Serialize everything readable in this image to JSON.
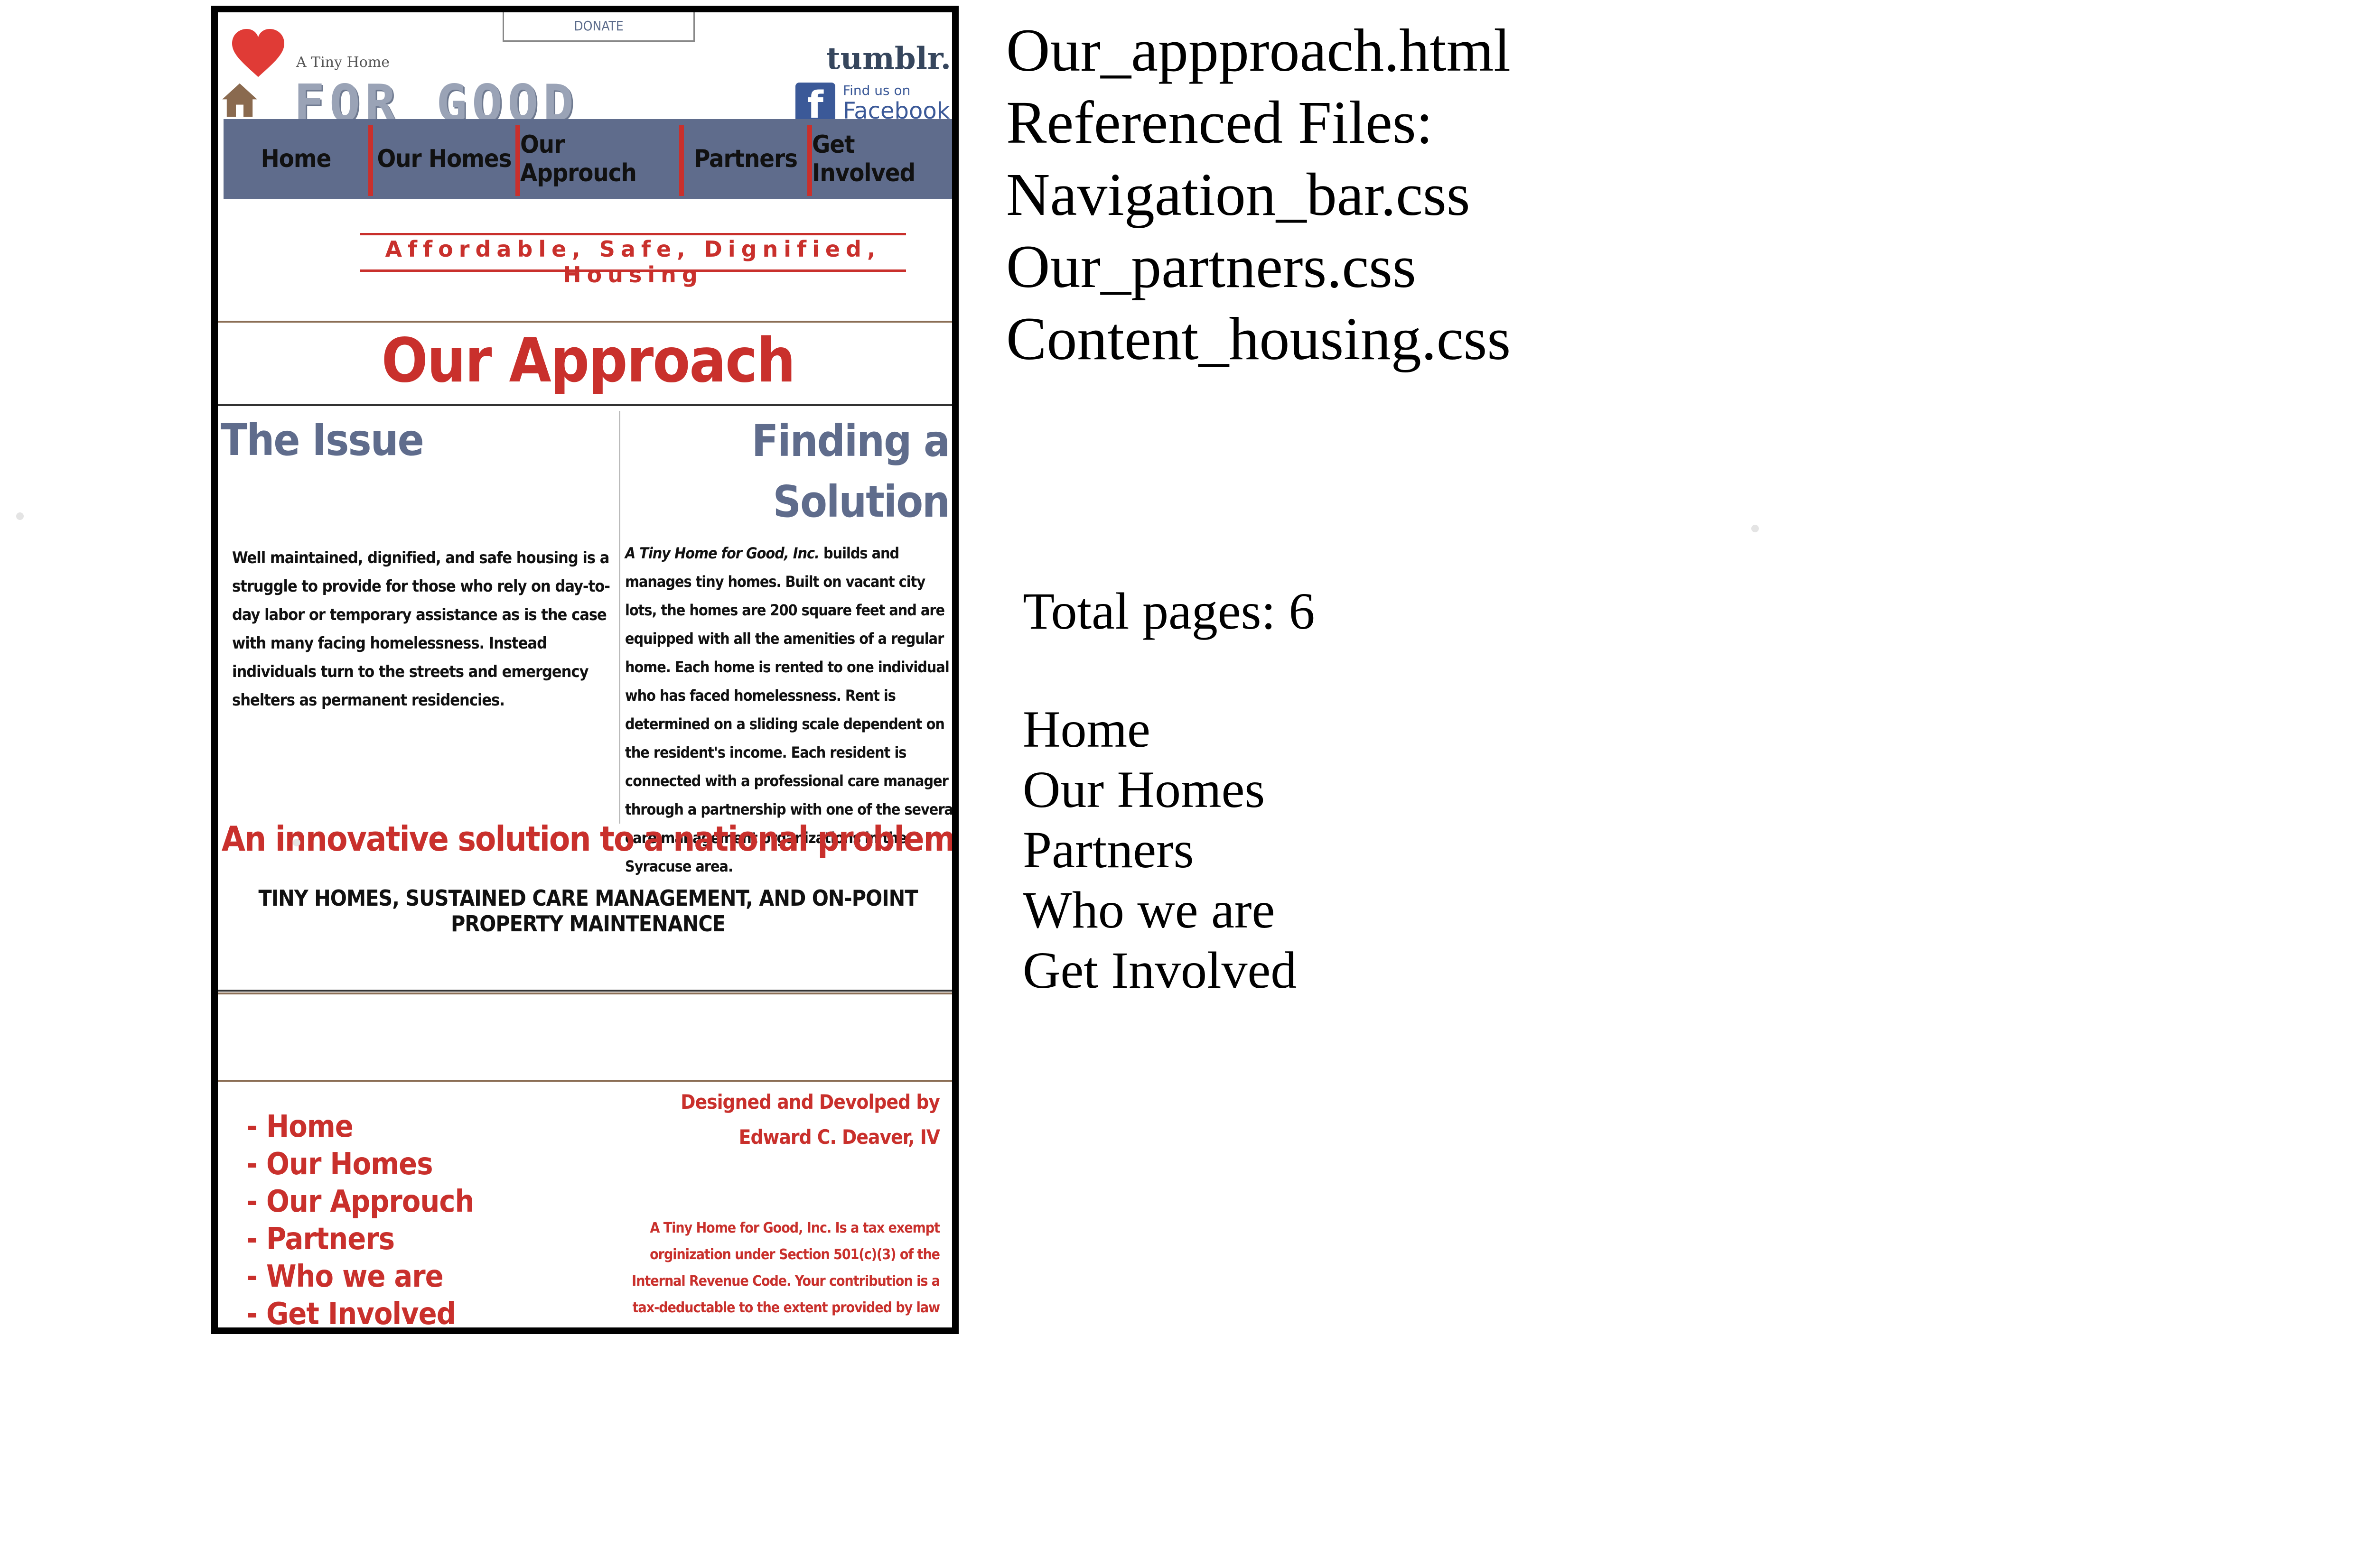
{
  "mockup": {
    "donate": "DONATE",
    "logo_small": "A Tiny Home",
    "logo_big": "FOR GOOD",
    "tumblr": "tumblr.",
    "facebook_small": "Find us on",
    "facebook_big": "Facebook",
    "nav": [
      "Home",
      "Our Homes",
      "Our Approuch",
      "Partners",
      "Get Involved"
    ],
    "tagline": "Affordable, Safe, Dignified, Housing",
    "page_title": "Our Approach",
    "issue_title": "The Issue",
    "solution_title_1": "Finding a",
    "solution_title_2": "Solution",
    "issue_body": "Well maintained, dignified, and safe housing is a struggle to provide for those who rely on day-to-day labor or temporary assistance as is the case with many facing homelessness. Instead individuals turn to the streets and emergency shelters as permanent residencies.",
    "solution_org": "A Tiny Home for Good, Inc.",
    "solution_body": " builds and manages tiny homes. Built on vacant city lots, the homes are 200 square feet and are equipped with all the amenities of a regular home. Each home is rented to one individual who has faced homelessness. Rent is determined on a sliding scale dependent on the resident's income. Each resident is connected with a professional care manager through a partnership with one of the several care management organizations in the Syracuse area.",
    "innovative": "An innovative solution to a national problem",
    "caps_line": "TINY HOMES, SUSTAINED CARE MANAGEMENT, AND ON-POINT PROPERTY MAINTENANCE",
    "footer_links": [
      "Home",
      "Our Homes",
      "Our Approuch",
      "Partners",
      "Who we are",
      "Get Involved"
    ],
    "credit_1": "Designed and Devolped by",
    "credit_2": "Edward C. Deaver, IV",
    "taxnote": "A  Tiny Home for Good, Inc. Is a tax exempt orginization under Section 501(c)(3) of the Internal Revenue Code. Your contribution is a tax-deductable to the extent provided by law",
    "brand_red": "#c9302c",
    "nav_blue": "#5f6c8c"
  },
  "notes": {
    "files": [
      "Our_appproach.html",
      "Referenced Files:",
      "Navigation_bar.css",
      "Our_partners.css",
      "Content_housing.css"
    ],
    "total_pages": "Total pages: 6",
    "pages": [
      "Home",
      "Our Homes",
      "Partners",
      "Who we are",
      "Get Involved"
    ]
  }
}
